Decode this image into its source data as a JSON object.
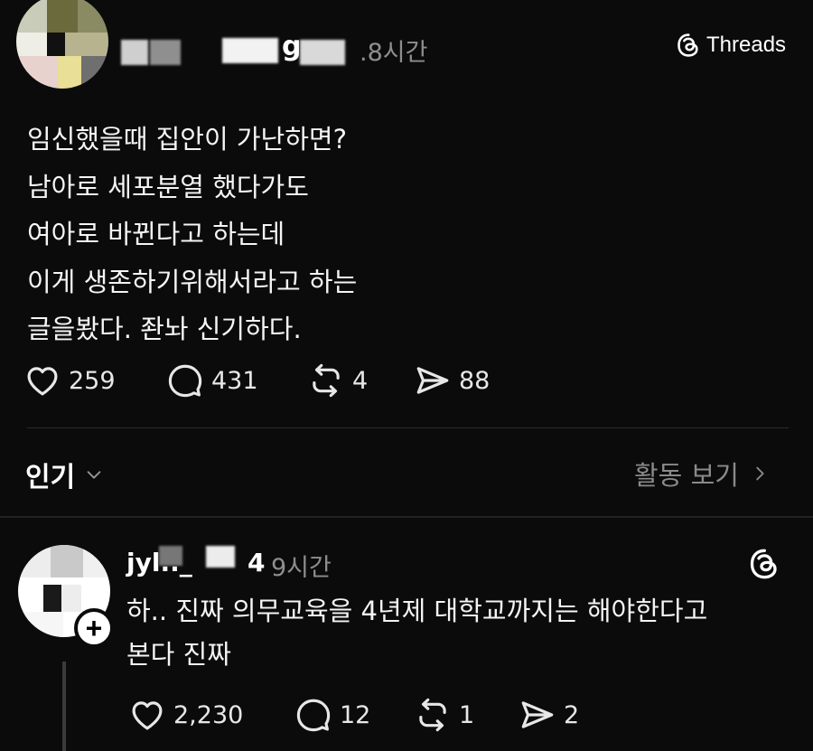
{
  "post": {
    "username": "g",
    "time": ".8시간",
    "brand": "Threads",
    "lines": [
      "임신했을때 집안이 가난하면?",
      "남아로 세포분열 했다가도",
      "여아로 바뀐다고 하는데",
      "이게 생존하기위해서라고 하는",
      "글을봤다. 좐놔 신기하다."
    ],
    "actions": {
      "likes": "259",
      "comments": "431",
      "reposts": "4",
      "shares": "88"
    }
  },
  "filter": {
    "popular_label": "인기",
    "activity_label": "활동 보기"
  },
  "reply": {
    "username": "jyl.._",
    "username_tail": "4",
    "time": "9시간",
    "lines": [
      "하.. 진짜 의무교육을 4년제 대학교까지는 해야한다고",
      "본다 진짜"
    ],
    "actions": {
      "likes": "2,230",
      "comments": "12",
      "reposts": "1",
      "shares": "2"
    }
  },
  "icons": {
    "like": "heart-icon",
    "comment": "comment-bubble-icon",
    "repost": "repost-icon",
    "share": "send-icon",
    "brand": "threads-logo-icon",
    "follow": "plus-icon",
    "chevron_down": "chevron-down-icon",
    "chevron_right": "chevron-right-icon"
  },
  "colors": {
    "background": "#0b0b0b",
    "text": "#f3f3f3",
    "muted": "#8e8e8e"
  }
}
